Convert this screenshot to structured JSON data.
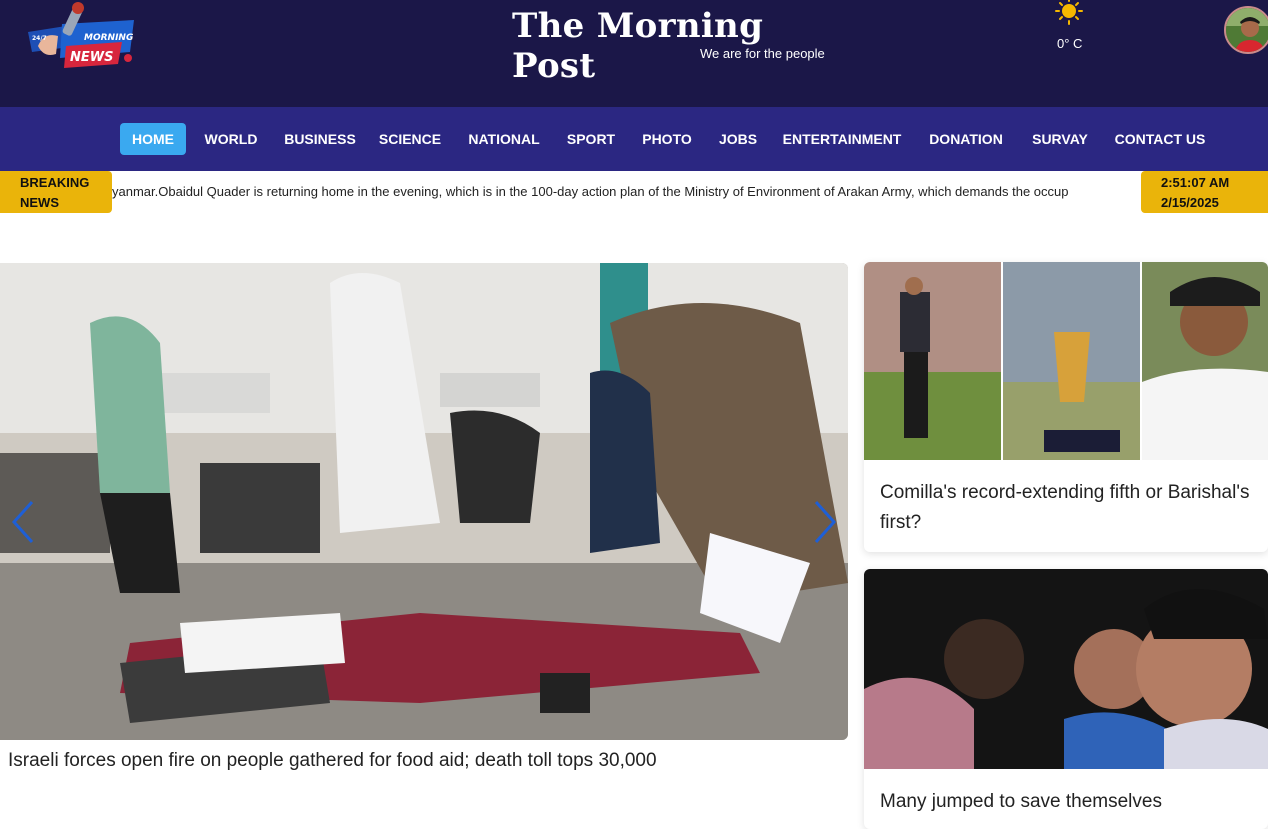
{
  "header": {
    "logo": {
      "top_text": "24/7",
      "word1": "MORNING",
      "word2": "NEWS"
    },
    "site_title": "The Morning Post",
    "tagline": "We are for the people",
    "weather": {
      "icon": "sun-icon",
      "temperature": "0° C"
    },
    "avatar": "user-avatar"
  },
  "nav": {
    "items": [
      {
        "label": "HOME",
        "active": true
      },
      {
        "label": "WORLD"
      },
      {
        "label": "BUSINESS"
      },
      {
        "label": "SCIENCE"
      },
      {
        "label": "NATIONAL"
      },
      {
        "label": "SPORT"
      },
      {
        "label": "PHOTO"
      },
      {
        "label": "JOBS"
      },
      {
        "label": "ENTERTAINMENT"
      },
      {
        "label": "DONATION"
      },
      {
        "label": "SURVAY"
      },
      {
        "label": "CONTACT US"
      }
    ]
  },
  "breaking": {
    "label_line1": "BREAKING",
    "label_line2": "NEWS",
    "ticker_text": "yanmar.Obaidul Quader is returning home in the evening, which is in the 100-day action plan of the Ministry of Environment of Arakan Army, which demands the occup",
    "time": "2:51:07 AM",
    "date": "2/15/2025"
  },
  "hero": {
    "caption": "Israeli forces open fire on people gathered for food aid; death toll tops 30,000"
  },
  "side_cards": [
    {
      "title": "Comilla's record-extending fifth or Barishal's first?"
    },
    {
      "title": "Many jumped to save themselves"
    }
  ],
  "colors": {
    "header_bg": "#1b1748",
    "nav_bg": "#2b2782",
    "nav_active": "#3aa9f0",
    "breaking_bg": "#eab40a",
    "arrow": "#1e5fd6"
  }
}
